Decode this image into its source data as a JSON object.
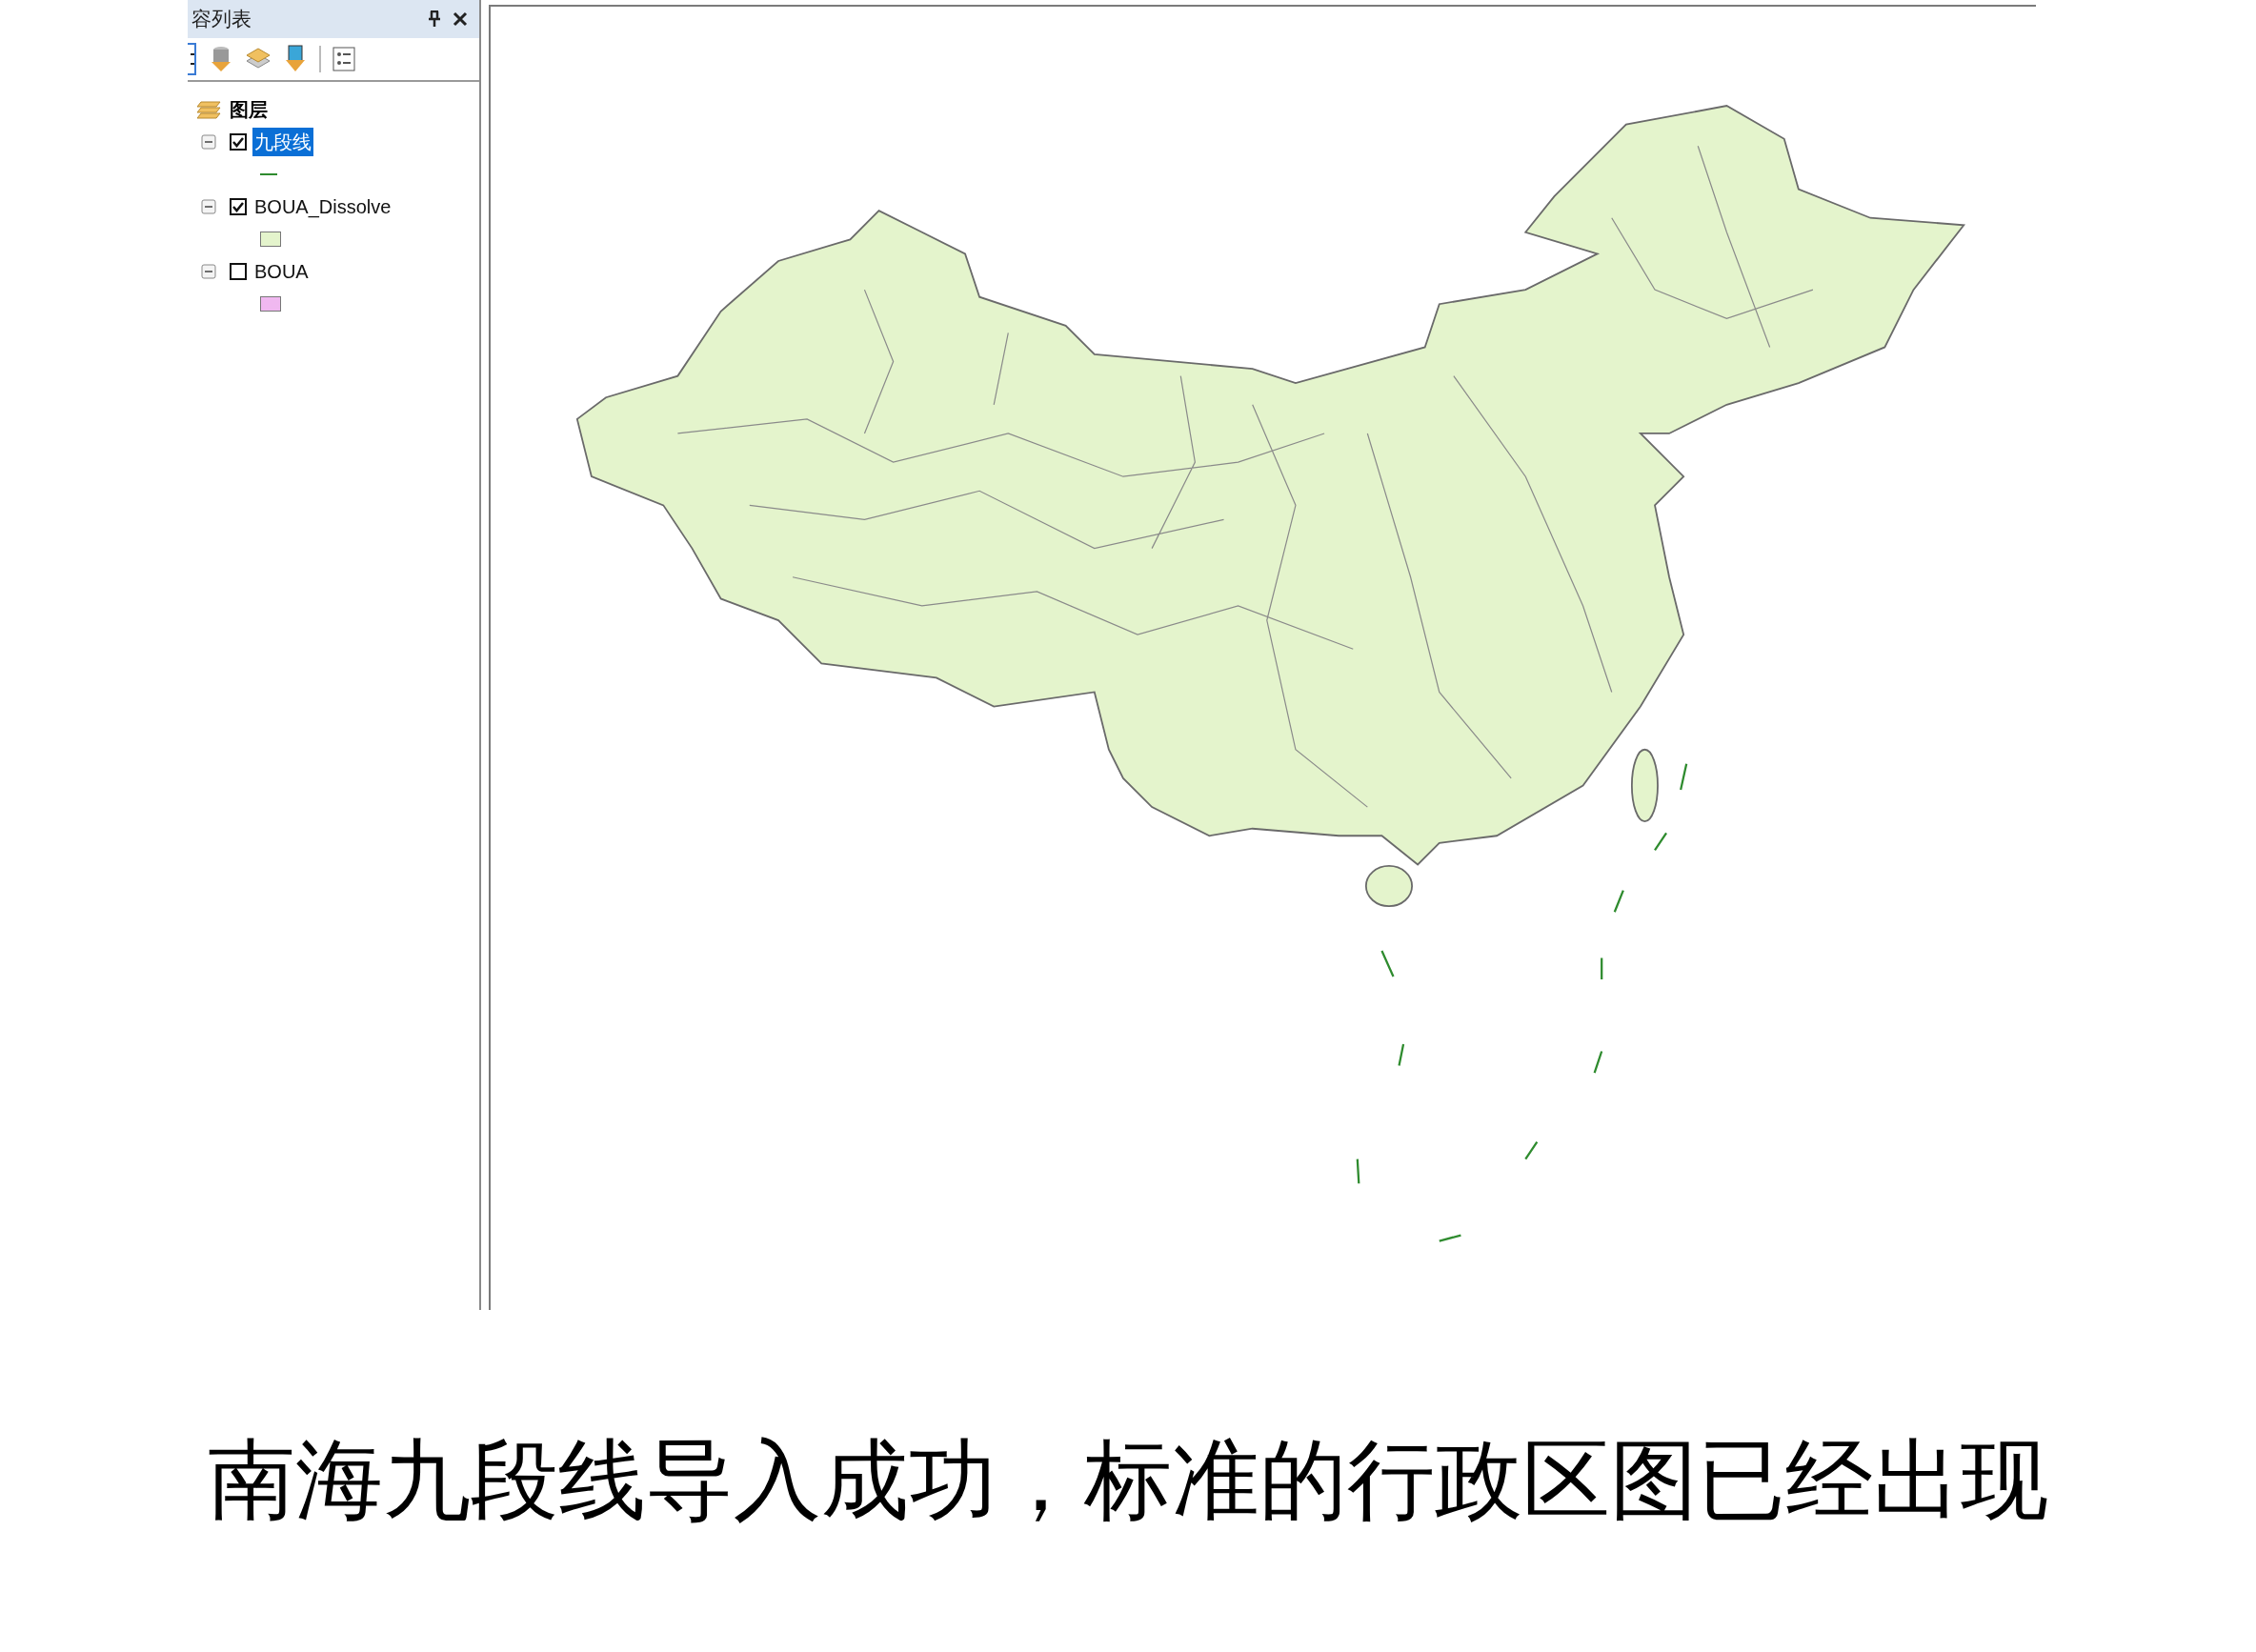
{
  "toc_panel": {
    "title": "容列表",
    "root": {
      "label": "图层",
      "layers": [
        {
          "label": "九段线",
          "checked": true,
          "selected": true,
          "expanded": true,
          "symbol": {
            "kind": "line",
            "color": "#2e8b2e"
          }
        },
        {
          "label": "BOUA_Dissolve",
          "checked": true,
          "selected": false,
          "expanded": true,
          "symbol": {
            "kind": "fill",
            "color": "#e4f4cc"
          }
        },
        {
          "label": "BOUA",
          "checked": false,
          "selected": false,
          "expanded": true,
          "symbol": {
            "kind": "fill",
            "color": "#f0b8f0"
          }
        }
      ]
    }
  },
  "caption": "南海九段线导入成功，标准的行政区图已经出现"
}
